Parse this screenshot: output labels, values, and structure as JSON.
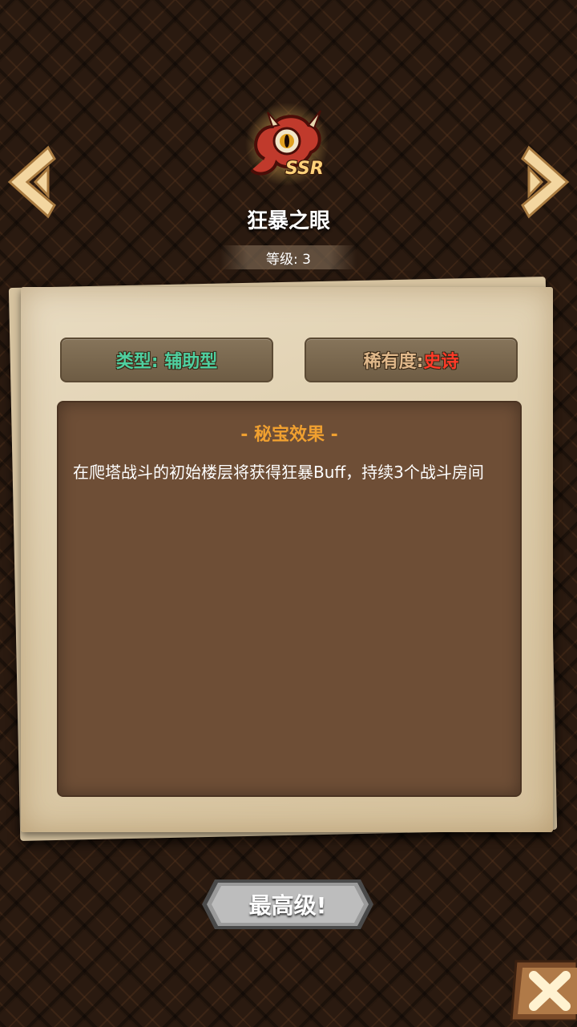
{
  "relic": {
    "name": "狂暴之眼",
    "rarity_badge": "SSR",
    "level_label": "等级: 3"
  },
  "info": {
    "type_label": "类型: 辅助型",
    "rarity_label": "稀有度: ",
    "rarity_value": "史诗"
  },
  "effect": {
    "title": "- 秘宝效果 -",
    "description": "在爬塔战斗的初始楼层将获得狂暴Buff，持续3个战斗房间"
  },
  "actions": {
    "max_level_label": "最高级!"
  },
  "icons": {
    "prev": "chevron-left-icon",
    "next": "chevron-right-icon",
    "close": "close-icon",
    "relic": "demon-eye-icon"
  },
  "colors": {
    "type_text": "#4fd0a0",
    "rarity_value": "#ff3a28",
    "effect_title": "#f0a030"
  }
}
